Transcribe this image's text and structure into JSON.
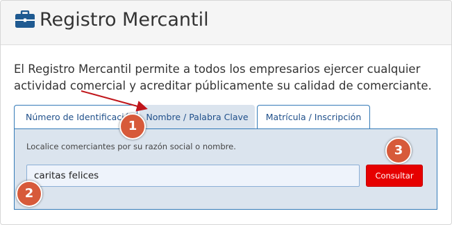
{
  "header": {
    "title": "Registro Mercantil",
    "icon": "briefcase-icon"
  },
  "main": {
    "description": "El Registro Mercantil permite a todos los empresarios ejercer cualquier actividad comercial y acreditar públicamente su calidad de comerciante.",
    "tabs": [
      {
        "label": "Número de Identificación",
        "active": false
      },
      {
        "label": "Nombre / Palabra Clave",
        "active": true
      },
      {
        "label": "Matrícula / Inscripción",
        "active": false
      }
    ],
    "panel": {
      "hint": "Localice comerciantes por su razón social o nombre.",
      "search_value": "caritas felices",
      "button_label": "Consultar"
    }
  },
  "annotations": {
    "callouts": [
      "1",
      "2",
      "3"
    ]
  },
  "colors": {
    "accent": "#337ab7",
    "panel_bg": "#dbe4ee",
    "button": "#e60000",
    "callout": "#d75a3a",
    "arrow": "#c0161b"
  }
}
